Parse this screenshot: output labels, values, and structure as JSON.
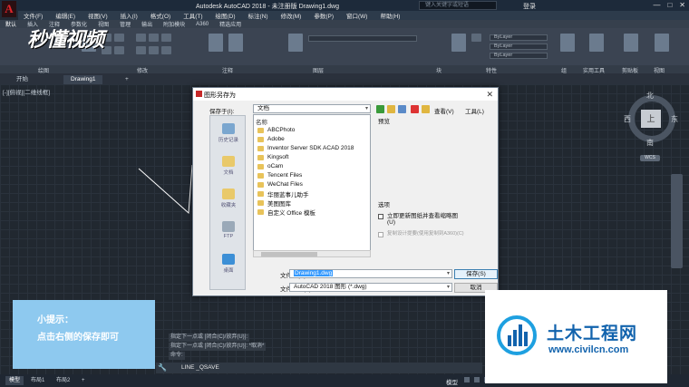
{
  "app": {
    "title": "Autodesk AutoCAD 2018 - 未注册版    Drawing1.dwg",
    "logo_letter": "A",
    "search_placeholder": "键入关键字或短语",
    "login_label": "登录",
    "window_buttons": [
      "—",
      "□",
      "✕"
    ]
  },
  "brand_watermark": "秒懂视频",
  "menu": [
    "文件(F)",
    "编辑(E)",
    "视图(V)",
    "插入(I)",
    "格式(O)",
    "工具(T)",
    "绘图(D)",
    "标注(N)",
    "修改(M)",
    "参数(P)",
    "窗口(W)",
    "帮助(H)"
  ],
  "ribbon": {
    "tabs": [
      "默认",
      "插入",
      "注释",
      "参数化",
      "视图",
      "管理",
      "输出",
      "附加模块",
      "A360",
      "精选应用"
    ],
    "active_tab": "默认",
    "panels": [
      "绘图",
      "修改",
      "注释",
      "图层",
      "块",
      "特性",
      "组",
      "实用工具",
      "剪贴板",
      "视图"
    ],
    "bylayer": [
      "ByLayer",
      "ByLayer",
      "ByLayer"
    ]
  },
  "doc_tabs": [
    "开始",
    "Drawing1",
    "+"
  ],
  "viewport_label": "[-][俯视][二维线框]",
  "viewcube": {
    "top": "上",
    "north": "北",
    "south": "南",
    "west": "西",
    "east": "东",
    "wcs": "WCS"
  },
  "dialog": {
    "title": "图形另存为",
    "save_in_label": "保存于(I):",
    "save_in_value": "文档",
    "views_label": "查看(V)",
    "tools_label": "工具(L)",
    "places": [
      "历史记录",
      "文档",
      "收藏夹",
      "FTP",
      "桌面"
    ],
    "list_header": "名称",
    "folders": [
      "ABCPhoto",
      "Adobe",
      "Inventor Server SDK ACAD 2018",
      "Kingsoft",
      "oCam",
      "Tencent Files",
      "WeChat Files",
      "华丽蓝事儿助手",
      "美图图库",
      "自定义 Office 模板"
    ],
    "preview_label": "预览",
    "options_label": "选项",
    "option1": "立即更新图纸并查看缩略图(U)",
    "option2": "复制设计提要(使用复制到A360)(C)",
    "filename_label": "文件名(N):",
    "filename_value": "Drawing1.dwg",
    "filetype_label": "文件类型(T):",
    "filetype_value": "AutoCAD 2018 图形 (*.dwg)",
    "save_button": "保存(S)",
    "cancel_button": "取消"
  },
  "tip": {
    "title": "小提示：",
    "body": "点击右侧的保存即可"
  },
  "command_history": [
    "指定下一点或 [闭合(C)/放弃(U)]:",
    "指定下一点或 [闭合(C)/放弃(U)]: *取消*",
    "命令:"
  ],
  "command_line": "LINE _QSAVE",
  "status": {
    "tabs": [
      "模型",
      "布局1",
      "布局2",
      "+"
    ],
    "model_label": "模型"
  },
  "site_watermark": {
    "title": "土木工程网",
    "url": "www.civilcn.com"
  }
}
